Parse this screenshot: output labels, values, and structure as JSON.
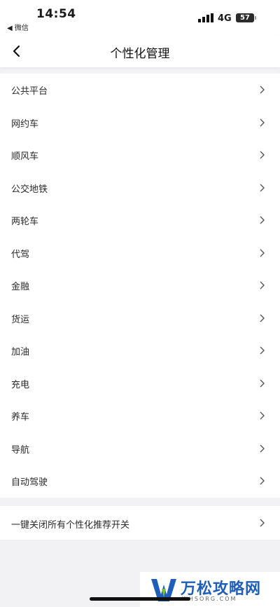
{
  "status_bar": {
    "time": "14:54",
    "back_app": "◀ 微信",
    "network": "4G",
    "battery": "57"
  },
  "header": {
    "title": "个性化管理"
  },
  "menu": {
    "items": [
      {
        "label": "公共平台"
      },
      {
        "label": "网约车"
      },
      {
        "label": "顺风车"
      },
      {
        "label": "公交地铁"
      },
      {
        "label": "两轮车"
      },
      {
        "label": "代驾"
      },
      {
        "label": "金融"
      },
      {
        "label": "货运"
      },
      {
        "label": "加油"
      },
      {
        "label": "充电"
      },
      {
        "label": "养车"
      },
      {
        "label": "导航"
      },
      {
        "label": "自动驾驶"
      }
    ]
  },
  "global_switch": {
    "label": "一键关闭所有个性化推荐开关"
  },
  "watermark": {
    "title": "万松攻略网",
    "url": "WHSORG.COM"
  },
  "colors": {
    "background": "#f2f2f4",
    "watermark_blue": "#1f5fb8"
  }
}
